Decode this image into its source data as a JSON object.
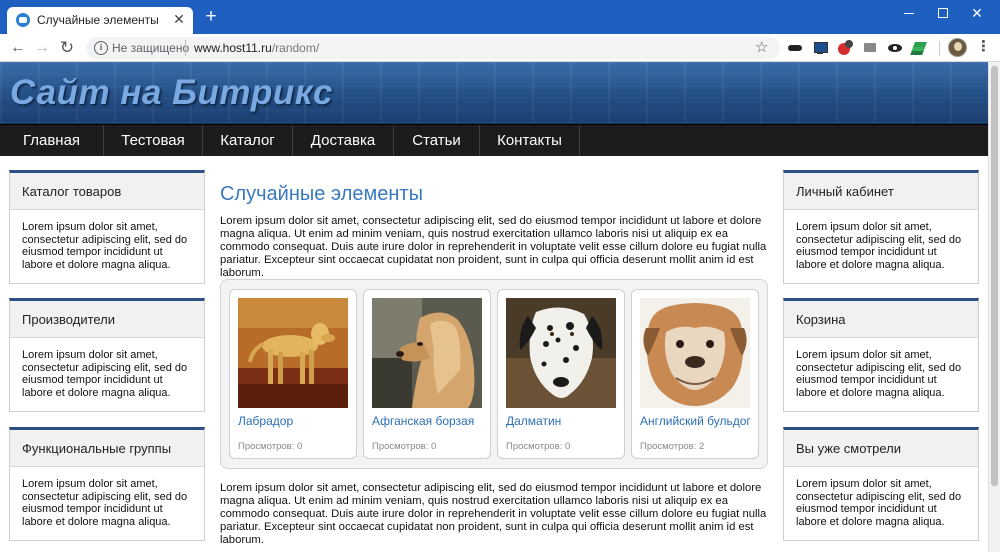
{
  "browser": {
    "tab_title": "Случайные элементы",
    "tab_close": "✕",
    "new_tab": "+",
    "insecure_label": "Не защищено",
    "url_host": "www.host11.ru",
    "url_path": "/random/",
    "icons": [
      "back-arrow-icon",
      "forward-arrow-icon",
      "reload-icon",
      "info-icon",
      "star-icon",
      "mask-icon",
      "monitor-icon",
      "red-ext-icon",
      "grey-ext-icon",
      "eye-icon",
      "stack-icon",
      "avatar",
      "menu-dots-icon"
    ]
  },
  "site": {
    "title": "Сайт на Битрикс"
  },
  "nav": {
    "items": [
      "Главная",
      "Тестовая",
      "Каталог",
      "Доставка",
      "Статьи",
      "Контакты"
    ]
  },
  "left_blocks": [
    {
      "title": "Каталог товаров",
      "text": "Lorem ipsum dolor sit amet, consectetur adipiscing elit, sed do eiusmod tempor incididunt ut labore et dolore magna aliqua."
    },
    {
      "title": "Производители",
      "text": "Lorem ipsum dolor sit amet, consectetur adipiscing elit, sed do eiusmod tempor incididunt ut labore et dolore magna aliqua."
    },
    {
      "title": "Функциональные группы",
      "text": "Lorem ipsum dolor sit amet, consectetur adipiscing elit, sed do eiusmod tempor incididunt ut labore et dolore magna aliqua."
    }
  ],
  "right_blocks": [
    {
      "title": "Личный кабинет",
      "text": "Lorem ipsum dolor sit amet, consectetur adipiscing elit, sed do eiusmod tempor incididunt ut labore et dolore magna aliqua."
    },
    {
      "title": "Корзина",
      "text": "Lorem ipsum dolor sit amet, consectetur adipiscing elit, sed do eiusmod tempor incididunt ut labore et dolore magna aliqua."
    },
    {
      "title": "Вы уже смотрели",
      "text": "Lorem ipsum dolor sit amet, consectetur adipiscing elit, sed do eiusmod tempor incididunt ut labore et dolore magna aliqua."
    }
  ],
  "main": {
    "title": "Случайные элементы",
    "intro": "Lorem ipsum dolor sit amet, consectetur adipiscing elit, sed do eiusmod tempor incididunt ut labore et dolore magna aliqua. Ut enim ad minim veniam, quis nostrud exercitation ullamco laboris nisi ut aliquip ex ea commodo consequat. Duis aute irure dolor in reprehenderit in voluptate velit esse cillum dolore eu fugiat nulla pariatur. Excepteur sint occaecat cupidatat non proident, sunt in culpa qui officia deserunt mollit anim id est laborum.",
    "outro": "Lorem ipsum dolor sit amet, consectetur adipiscing elit, sed do eiusmod tempor incididunt ut labore et dolore magna aliqua. Ut enim ad minim veniam, quis nostrud exercitation ullamco laboris nisi ut aliquip ex ea commodo consequat. Duis aute irure dolor in reprehenderit in voluptate velit esse cillum dolore eu fugiat nulla pariatur. Excepteur sint occaecat cupidatat non proident, sunt in culpa qui officia deserunt mollit anim id est laborum.",
    "items": [
      {
        "name": "Лабрадор",
        "views": "Просмотров: 0"
      },
      {
        "name": "Афганская борзая",
        "views": "Просмотров: 0"
      },
      {
        "name": "Далматин",
        "views": "Просмотров: 0"
      },
      {
        "name": "Английский бульдог",
        "views": "Просмотров: 2"
      }
    ]
  },
  "colors": {
    "titlebar": "#1f5fbf",
    "accent_blue": "#3a79c0",
    "link_blue": "#2c6fb8",
    "nav_bg": "#1c1c1c",
    "block_top": "#2e4f84"
  }
}
